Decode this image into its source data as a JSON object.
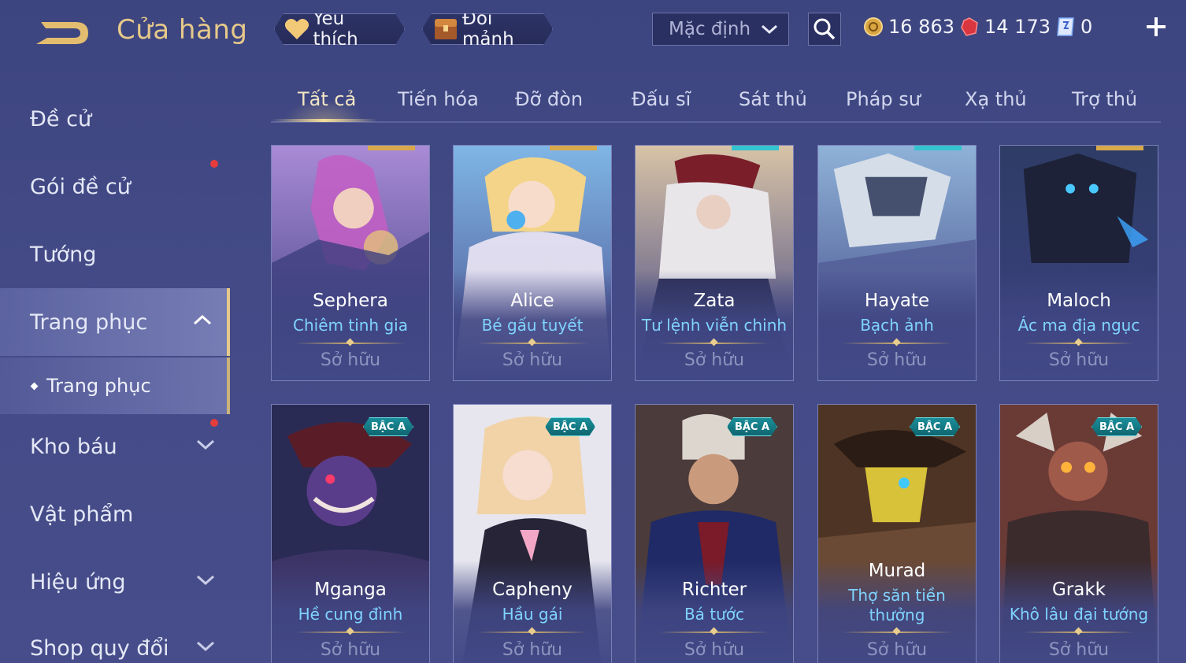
{
  "header": {
    "title": "Cửa hàng",
    "favorite_label": "Yêu thích",
    "shard_label": "Đổi mảnh",
    "sort_value": "Mặc định",
    "currencies": [
      {
        "name": "gold",
        "value": "16 863"
      },
      {
        "name": "ruby",
        "value": "14 173"
      },
      {
        "name": "coupon",
        "value": "0"
      }
    ]
  },
  "sidebar": {
    "items": [
      {
        "label": "Đề cử"
      },
      {
        "label": "Gói đề cử"
      },
      {
        "label": "Tướng"
      },
      {
        "label": "Trang phục"
      },
      {
        "label": "Kho báu"
      },
      {
        "label": "Vật phẩm"
      },
      {
        "label": "Hiệu ứng"
      },
      {
        "label": "Shop quy đổi"
      }
    ],
    "sub_item": "Trang phục"
  },
  "tabs": [
    "Tất cả",
    "Tiến hóa",
    "Đỡ đòn",
    "Đấu sĩ",
    "Sát thủ",
    "Pháp sư",
    "Xạ thủ",
    "Trợ thủ"
  ],
  "cards": [
    {
      "hero": "Sephera",
      "skin": "Chiêm tinh gia",
      "status": "Sở hữu",
      "top_color": "#d8a94c"
    },
    {
      "hero": "Alice",
      "skin": "Bé gấu tuyết",
      "status": "Sở hữu",
      "top_color": "#d8a94c"
    },
    {
      "hero": "Zata",
      "skin": "Tư lệnh viễn chinh",
      "status": "Sở hữu",
      "top_color": "#34c4cf"
    },
    {
      "hero": "Hayate",
      "skin": "Bạch ảnh",
      "status": "Sở hữu",
      "top_color": "#34c4cf"
    },
    {
      "hero": "Maloch",
      "skin": "Ác ma địa ngục",
      "status": "Sở hữu",
      "top_color": "#d8a94c"
    },
    {
      "hero": "Mganga",
      "skin": "Hề cung đình",
      "status": "Sở hữu",
      "badge": "BẬC A"
    },
    {
      "hero": "Capheny",
      "skin": "Hầu gái",
      "status": "Sở hữu",
      "badge": "BẬC A"
    },
    {
      "hero": "Richter",
      "skin": "Bá tước",
      "status": "Sở hữu",
      "badge": "BẬC A"
    },
    {
      "hero": "Murad",
      "skin_line1": "Thợ săn tiền",
      "skin_line2": "thưởng",
      "status": "Sở hữu",
      "badge": "BẬC A"
    },
    {
      "hero": "Grakk",
      "skin": "Khô lâu đại tướng",
      "status": "Sở hữu",
      "badge": "BẬC A"
    }
  ],
  "colors": {
    "accent_gold": "#e6c98a",
    "skin_name": "#7fd3ff",
    "badge_teal": "#1a8f9a",
    "notification_red": "#e53c3c"
  },
  "icons": {
    "back": "back-arrow-icon",
    "favorite": "heart-icon",
    "shard": "treasure-chest-icon",
    "search": "search-icon",
    "gold": "gold-coin-icon",
    "ruby": "ruby-gem-icon",
    "coupon": "coupon-icon",
    "add": "plus-icon"
  }
}
